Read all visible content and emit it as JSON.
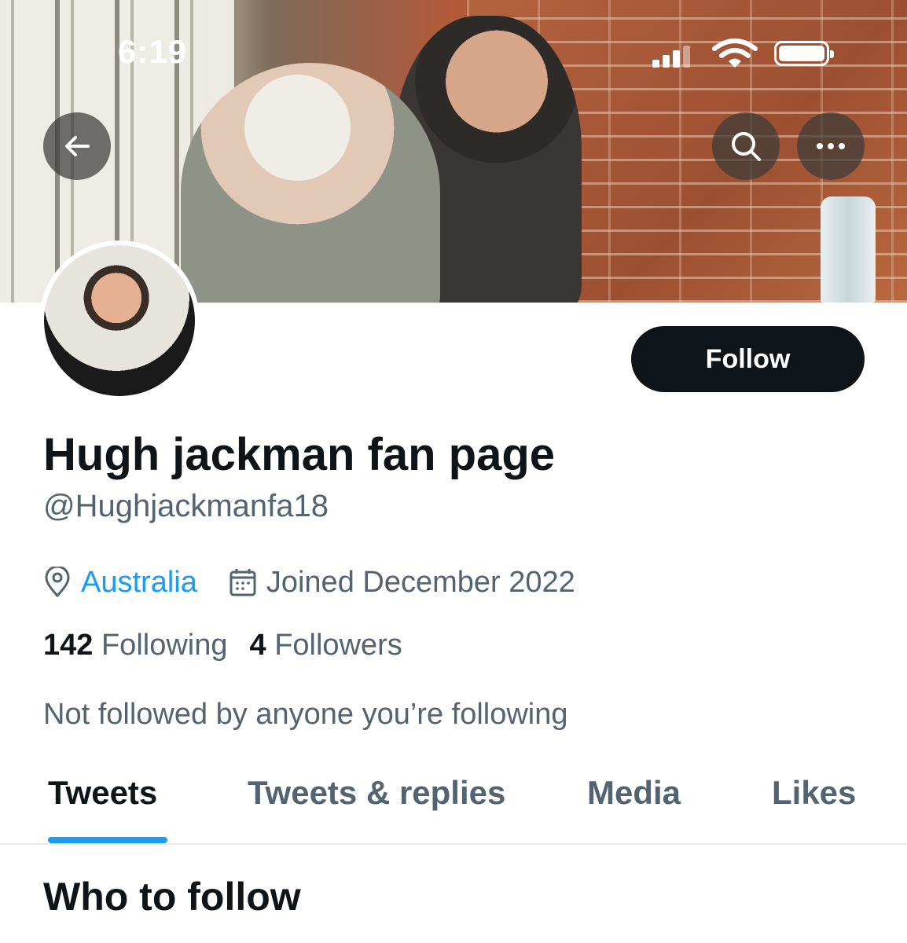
{
  "status_bar": {
    "time": "6:19"
  },
  "profile": {
    "name": "Hugh jackman fan page",
    "handle": "@Hughjackmanfa18",
    "location": "Australia",
    "joined": "Joined December 2022",
    "following_count": "142",
    "following_label": "Following",
    "followers_count": "4",
    "followers_label": "Followers",
    "not_followed_text": "Not followed by anyone you’re following"
  },
  "actions": {
    "follow_label": "Follow"
  },
  "tabs": [
    {
      "label": "Tweets",
      "active": true
    },
    {
      "label": "Tweets & replies"
    },
    {
      "label": "Media"
    },
    {
      "label": "Likes"
    }
  ],
  "section": {
    "who_to_follow": "Who to follow"
  },
  "colors": {
    "accent": "#1d9bf0",
    "text": "#0f1419",
    "secondary": "#536471"
  },
  "icons": [
    "back-arrow-icon",
    "search-icon",
    "more-icon",
    "location-icon",
    "calendar-icon",
    "signal-icon",
    "wifi-icon",
    "battery-icon"
  ]
}
